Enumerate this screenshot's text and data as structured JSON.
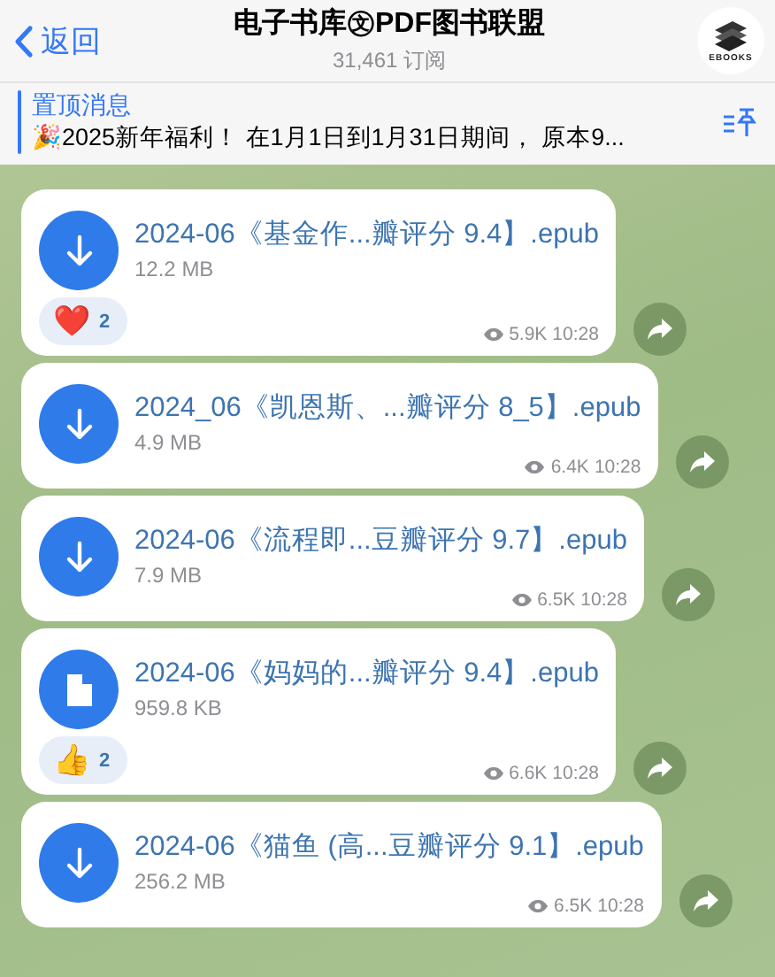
{
  "header": {
    "back": "返回",
    "title": "电子书库㉆PDF图书联盟",
    "subtitle": "31,461 订阅",
    "logo_text": "EBOOKS"
  },
  "pinned": {
    "label": "置顶消息",
    "text": "🎉2025新年福利！ 在1月1日到1月31日期间， 原本9..."
  },
  "messages": [
    {
      "kind": "download",
      "name": "2024-06《基金作...瓣评分 9.4】.epub",
      "size": "12.2 MB",
      "reaction": {
        "emoji": "❤️",
        "count": "2"
      },
      "views": "5.9K",
      "time": "10:28"
    },
    {
      "kind": "download",
      "name": "2024_06《凯恩斯、...瓣评分 8_5】.epub",
      "size": "4.9 MB",
      "views": "6.4K",
      "time": "10:28"
    },
    {
      "kind": "download",
      "name": "2024-06《流程即...豆瓣评分 9.7】.epub",
      "size": "7.9 MB",
      "views": "6.5K",
      "time": "10:28"
    },
    {
      "kind": "file",
      "name": "2024-06《妈妈的...瓣评分 9.4】.epub",
      "size": "959.8 KB",
      "reaction": {
        "emoji": "👍",
        "count": "2"
      },
      "views": "6.6K",
      "time": "10:28"
    },
    {
      "kind": "download",
      "name": "2024-06《猫鱼 (高...豆瓣评分 9.1】.epub",
      "size": "256.2 MB",
      "views": "6.5K",
      "time": "10:28"
    }
  ]
}
